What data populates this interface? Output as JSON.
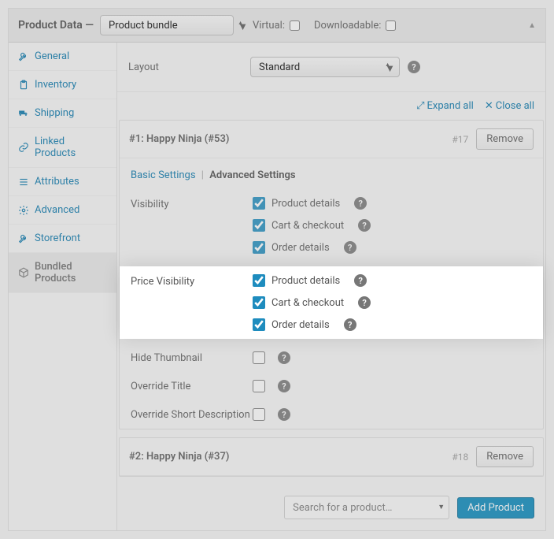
{
  "header": {
    "title_prefix": "Product Data —",
    "product_type": "Product bundle",
    "virtual_label": "Virtual:",
    "downloadable_label": "Downloadable:"
  },
  "sidebar": {
    "items": [
      {
        "label": "General"
      },
      {
        "label": "Inventory"
      },
      {
        "label": "Shipping"
      },
      {
        "label": "Linked Products"
      },
      {
        "label": "Attributes"
      },
      {
        "label": "Advanced"
      },
      {
        "label": "Storefront"
      },
      {
        "label": "Bundled Products"
      }
    ]
  },
  "layout": {
    "label": "Layout",
    "value": "Standard"
  },
  "tools": {
    "expand": "Expand all",
    "close": "Close all"
  },
  "items": [
    {
      "title": "#1: Happy Ninja (#53)",
      "order": "#17",
      "remove": "Remove",
      "subtabs": {
        "basic": "Basic Settings",
        "advanced": "Advanced Settings"
      },
      "settings": {
        "visibility": {
          "label": "Visibility",
          "options": [
            {
              "label": "Product details",
              "checked": true
            },
            {
              "label": "Cart & checkout",
              "checked": true
            },
            {
              "label": "Order details",
              "checked": true
            }
          ]
        },
        "price_visibility": {
          "label": "Price Visibility",
          "options": [
            {
              "label": "Product details",
              "checked": true
            },
            {
              "label": "Cart & checkout",
              "checked": true
            },
            {
              "label": "Order details",
              "checked": true
            }
          ]
        },
        "hide_thumbnail": {
          "label": "Hide Thumbnail",
          "checked": false
        },
        "override_title": {
          "label": "Override Title",
          "checked": false
        },
        "override_desc": {
          "label": "Override Short Description",
          "checked": false
        }
      }
    },
    {
      "title": "#2: Happy Ninja (#37)",
      "order": "#18",
      "remove": "Remove"
    }
  ],
  "footer": {
    "search_placeholder": "Search for a product…",
    "add_button": "Add Product"
  }
}
